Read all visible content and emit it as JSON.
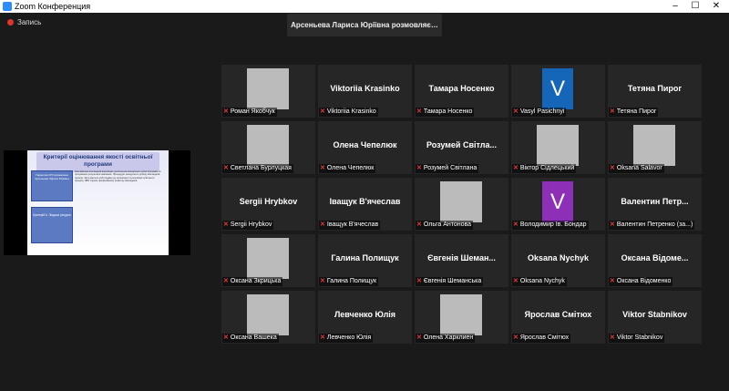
{
  "window": {
    "title": "Zoom Конференция"
  },
  "recording": {
    "label": "Запись"
  },
  "speaking_banner": "Арсеньева Лариса Юріївна розмовляє…",
  "shared_slide": {
    "title": "Критерії оцінювання якості освітньої програми",
    "box1": "Гарантом ОП призначена Арсеньєва Лариса Юріївна",
    "box2": "Критерій 6. Людські ресурси",
    "body": "Кваліфікація викладачів відповідає досягненню визначених цілей програми та програмних результатів навчання. Процедури конкурсного добору викладачів прозорі. Залучаються роботодавці до організації та реалізації освітнього процесу. ЗВО сприяє професійному розвитку викладачів."
  },
  "participants": [
    {
      "name": "Роман Якобчук",
      "label": "Роман Якобчук",
      "photo": "ph-man"
    },
    {
      "name": "Viktoriia Krasinko",
      "label": "Viktoriia Krasinko"
    },
    {
      "name": "Тамара Носенко",
      "label": "Тамара Носенко"
    },
    {
      "name": "Vasyl Pasichnyi",
      "label": "Vasyl Pasichnyi",
      "avatar": "V",
      "avatar_color": "#1565b8"
    },
    {
      "name": "Тетяна Пирог",
      "label": "Тетяна Пирог"
    },
    {
      "name": "Світлана Бурлуцкая",
      "label": "Светлана Бурлуцкая",
      "photo": "ph-lady1"
    },
    {
      "name": "Олена Чепелюк",
      "label": "Олена Чепелюк"
    },
    {
      "name": "Розумей Світла...",
      "label": "Розумей Світлана"
    },
    {
      "name": "Віктор Сідлецький",
      "label": "Віктор Сідлецький",
      "photo": "ph-man2"
    },
    {
      "name": "Oksana Salavor",
      "label": "Oksana Salavor",
      "photo": "ph-lady6"
    },
    {
      "name": "Sergii Hrybkov",
      "label": "Sergii Hrybkov"
    },
    {
      "name": "Іващук В'ячеслав",
      "label": "Іващук В'ячеслав"
    },
    {
      "name": "Ольга Антонова",
      "label": "Ольга Антонова",
      "photo": "ph-lady3"
    },
    {
      "name": "Володимир Бондар",
      "label": "Володимир Ів. Бондар",
      "avatar": "V",
      "avatar_color": "#8e2fb8"
    },
    {
      "name": "Валентин Петр...",
      "label": "Валентин Петренко (за...)"
    },
    {
      "name": "Оксана Зкрицька",
      "label": "Оксана Зкрицька",
      "photo": "ph-lady2"
    },
    {
      "name": "Галина Полищук",
      "label": "Галина Полищук"
    },
    {
      "name": "Євгенія Шеман...",
      "label": "Євгенія Шеманська"
    },
    {
      "name": "Oksana Nychyk",
      "label": "Oksana Nychyk"
    },
    {
      "name": "Оксана Відоме...",
      "label": "Оксана Відоменко"
    },
    {
      "name": "Оксана Вашека",
      "label": "Оксана Вашека",
      "photo": "ph-lady4"
    },
    {
      "name": "Левченко Юлія",
      "label": "Левченко Юлія"
    },
    {
      "name": "Олена Харклиен",
      "label": "Олена Харклиен",
      "photo": "ph-lady5"
    },
    {
      "name": "Ярослав Смітюх",
      "label": "Ярослав Смітюх"
    },
    {
      "name": "Viktor Stabnikov",
      "label": "Viktor Stabnikov"
    }
  ]
}
